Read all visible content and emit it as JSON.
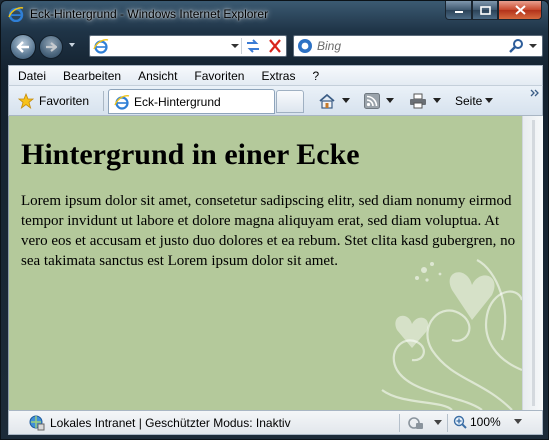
{
  "window": {
    "title": "Eck-Hintergrund - Windows Internet Explorer"
  },
  "address": {
    "value": ""
  },
  "search": {
    "placeholder": "Bing"
  },
  "menu": {
    "items": [
      "Datei",
      "Bearbeiten",
      "Ansicht",
      "Favoriten",
      "Extras",
      "?"
    ]
  },
  "favorites_bar": {
    "favorites_label": "Favoriten",
    "tab_label": "Eck-Hintergrund",
    "page_label": "Seite"
  },
  "page": {
    "heading": "Hintergrund in einer Ecke",
    "paragraph": "Lorem ipsum dolor sit amet, consetetur sadipscing elitr, sed diam nonumy eirmod tempor invidunt ut labore et dolore magna aliquyam erat, sed diam voluptua. At vero eos et accusam et justo duo dolores et ea rebum. Stet clita kasd gubergren, no sea takimata sanctus est Lorem ipsum dolor sit amet.",
    "background_color": "#b4c99b"
  },
  "status": {
    "zone_text": "Lokales Intranet | Geschützter Modus: Inaktiv",
    "zoom": "100%"
  },
  "icons": [
    "ie-logo-icon",
    "back-icon",
    "forward-icon",
    "refresh-icon",
    "stop-icon",
    "bing-icon",
    "search-icon",
    "favorites-star-icon",
    "home-icon",
    "feeds-icon",
    "print-icon",
    "chevron-right-icon",
    "intranet-icon",
    "protected-mode-icon",
    "zoom-icon"
  ]
}
